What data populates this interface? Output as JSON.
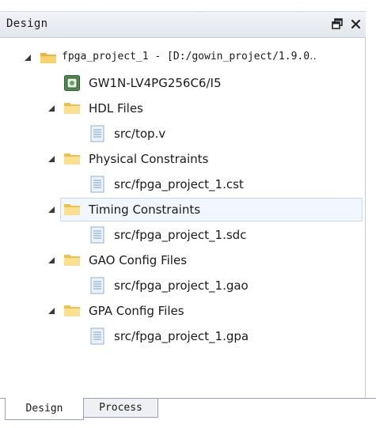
{
  "panel": {
    "title": "Design"
  },
  "tree": {
    "project": "fpga_project_1 - [D:/gowin_project/1.9.0‥",
    "device": "GW1N-LV4PG256C6/I5",
    "folders": [
      {
        "label": "HDL Files",
        "file": "src/top.v"
      },
      {
        "label": "Physical Constraints",
        "file": "src/fpga_project_1.cst"
      },
      {
        "label": "Timing Constraints",
        "file": "src/fpga_project_1.sdc"
      },
      {
        "label": "GAO Config Files",
        "file": "src/fpga_project_1.gao"
      },
      {
        "label": "GPA Config Files",
        "file": "src/fpga_project_1.gpa"
      }
    ]
  },
  "tabs": {
    "design": "Design",
    "process": "Process"
  },
  "colors": {
    "folder": "#f3c94f",
    "selection": "#f2f7fd"
  }
}
